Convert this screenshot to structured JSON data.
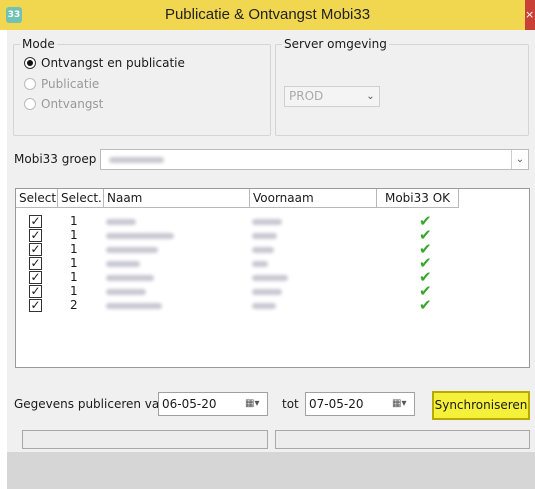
{
  "window": {
    "title": "Publicatie & Ontvangst Mobi33",
    "app_icon_text": "33",
    "close_label": "×"
  },
  "mode": {
    "legend": "Mode",
    "options": [
      {
        "label": "Ontvangst en publicatie",
        "selected": true,
        "enabled": true
      },
      {
        "label": "Publicatie",
        "selected": false,
        "enabled": false
      },
      {
        "label": "Ontvangst",
        "selected": false,
        "enabled": false
      }
    ]
  },
  "server": {
    "legend": "Server omgeving",
    "value": "PROD"
  },
  "group": {
    "label": "Mobi33 groep",
    "value": ""
  },
  "table": {
    "columns": [
      "Select.",
      "Select.",
      "Naam",
      "Voornaam",
      "Mobi33 OK"
    ],
    "rows": [
      {
        "checked": true,
        "select": "1",
        "ok": true
      },
      {
        "checked": true,
        "select": "1",
        "ok": true
      },
      {
        "checked": true,
        "select": "1",
        "ok": true
      },
      {
        "checked": true,
        "select": "1",
        "ok": true
      },
      {
        "checked": true,
        "select": "1",
        "ok": true
      },
      {
        "checked": true,
        "select": "1",
        "ok": true
      },
      {
        "checked": true,
        "select": "2",
        "ok": true
      }
    ]
  },
  "publish": {
    "label": "Gegevens publiceren van",
    "from": "06-05-20",
    "to_label": "tot",
    "to": "07-05-20",
    "sync_button": "Synchroniseren"
  },
  "colors": {
    "titlebar": "#f1d74f",
    "sync_button": "#f5f03a",
    "ok_check": "#3aa62f"
  }
}
